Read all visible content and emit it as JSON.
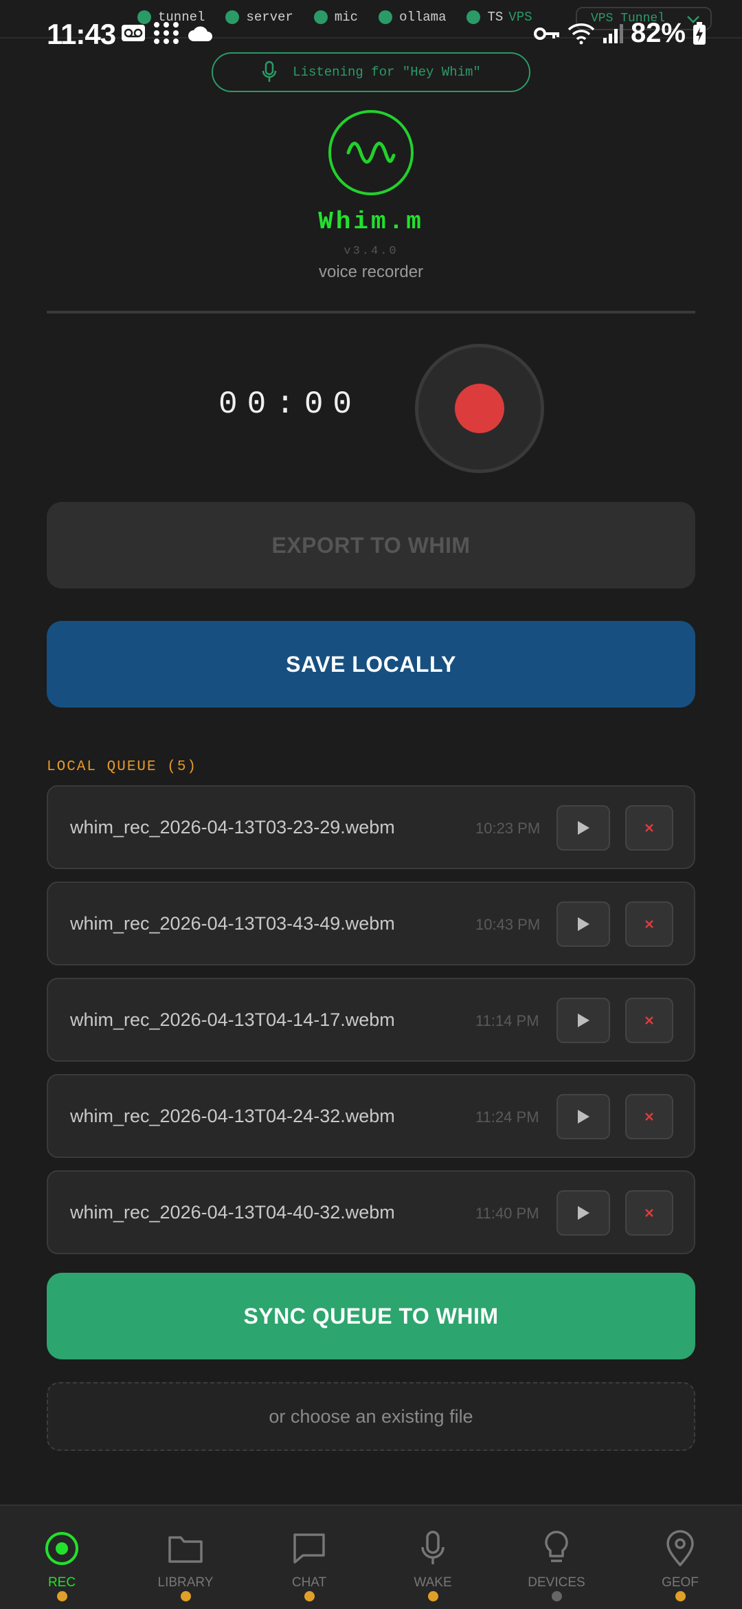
{
  "status_bar": {
    "time": "11:43",
    "battery": "82%"
  },
  "services": [
    {
      "label": "tunnel"
    },
    {
      "label": "server"
    },
    {
      "label": "mic"
    },
    {
      "label": "ollama"
    },
    {
      "label": "TS"
    }
  ],
  "vps": {
    "label": "VPS",
    "select_value": "VPS Tunnel"
  },
  "header": {
    "listening_text": "Listening for \"Hey Whim\"",
    "app_name": "Whim.m",
    "version": "v3.4.0",
    "subtitle": "voice recorder"
  },
  "recorder": {
    "timer": "00:00"
  },
  "actions": {
    "export_label": "EXPORT TO WHIM",
    "save_label": "SAVE LOCALLY",
    "sync_label": "SYNC QUEUE TO WHIM",
    "choose_file_label": "or choose an existing file"
  },
  "queue": {
    "title": "LOCAL QUEUE (5)",
    "items": [
      {
        "filename": "whim_rec_2026-04-13T03-23-29.webm",
        "time": "10:23 PM"
      },
      {
        "filename": "whim_rec_2026-04-13T03-43-49.webm",
        "time": "10:43 PM"
      },
      {
        "filename": "whim_rec_2026-04-13T04-14-17.webm",
        "time": "11:14 PM"
      },
      {
        "filename": "whim_rec_2026-04-13T04-24-32.webm",
        "time": "11:24 PM"
      },
      {
        "filename": "whim_rec_2026-04-13T04-40-32.webm",
        "time": "11:40 PM"
      }
    ],
    "play_glyph": "▶",
    "delete_glyph": "×"
  },
  "nav": {
    "items": [
      {
        "label": "REC",
        "icon": "record-icon",
        "active": true
      },
      {
        "label": "LIBRARY",
        "icon": "folder-icon"
      },
      {
        "label": "CHAT",
        "icon": "chat-bubble-icon"
      },
      {
        "label": "WAKE",
        "icon": "microphone-icon"
      },
      {
        "label": "DEVICES",
        "icon": "lightbulb-icon"
      },
      {
        "label": "GEOF",
        "icon": "location-pin-icon"
      }
    ]
  },
  "colors": {
    "accent_green": "#22e12c",
    "service_ok": "#2a9b67",
    "save_blue": "#175080",
    "sync_green": "#2da56e",
    "record_red": "#dd3c3c",
    "queue_orange": "#e89a2a"
  }
}
